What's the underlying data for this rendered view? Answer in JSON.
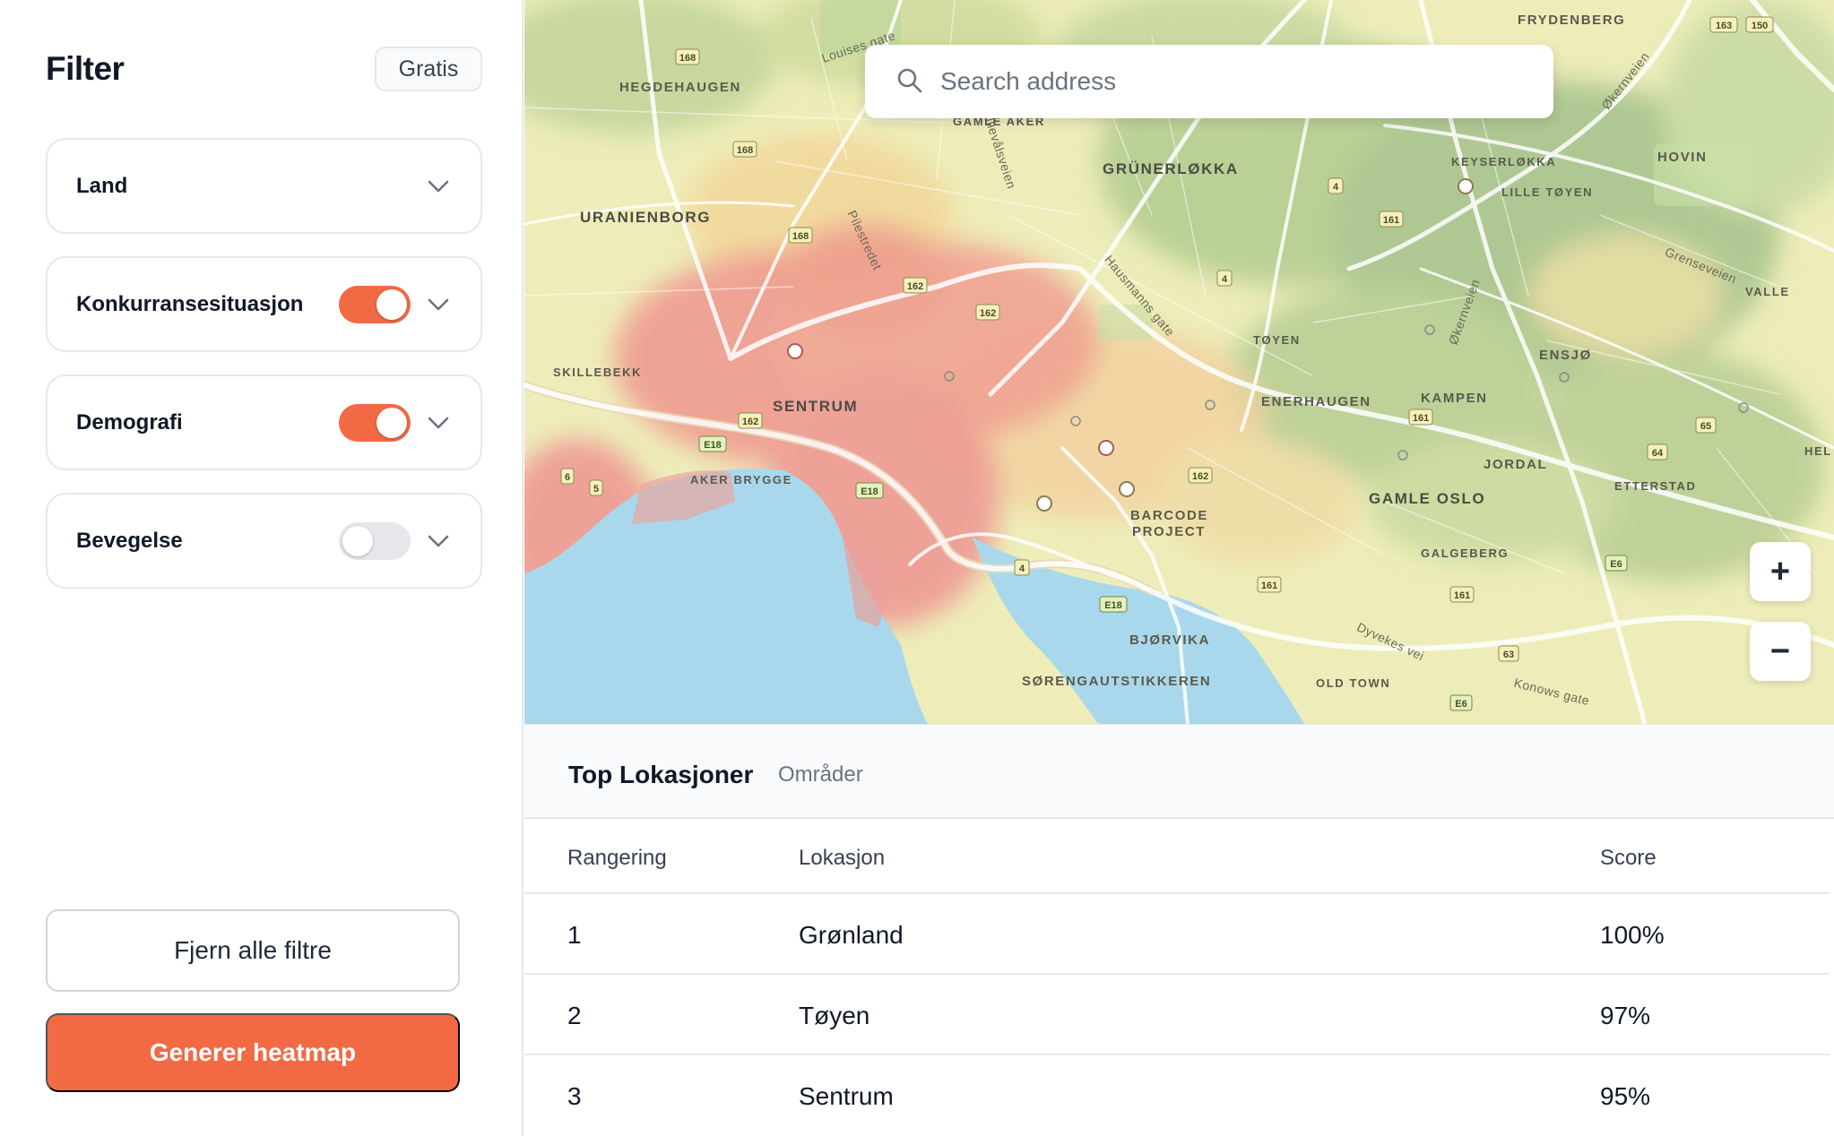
{
  "sidebar": {
    "title": "Filter",
    "plan_badge": "Gratis",
    "filters": [
      {
        "label": "Land",
        "has_toggle": false,
        "icon": "chevron-down-icon"
      },
      {
        "label": "Konkurransesituasjon",
        "has_toggle": true,
        "enabled": true,
        "icon": "chevron-down-icon"
      },
      {
        "label": "Demografi",
        "has_toggle": true,
        "enabled": true,
        "icon": "chevron-down-icon"
      },
      {
        "label": "Bevegelse",
        "has_toggle": true,
        "enabled": false,
        "icon": "chevron-down-icon"
      }
    ],
    "clear_button": "Fjern alle filtre",
    "generate_button": "Generer heatmap",
    "accent_color": "#f26a44"
  },
  "map": {
    "search_placeholder": "Search address",
    "search_icon": "search-icon",
    "zoom_in": "+",
    "zoom_out": "−",
    "labels": {
      "frydenberg": "FRYDENBERG",
      "hegdehaugen": "HEGDEHAUGEN",
      "gamle_aker": "GAMLE AKER",
      "grunerlokka": "GRÜNERLØKKA",
      "keyserlokka": "KEYSERLØKKA",
      "hovin": "HOVIN",
      "lille_toyen": "LILLE TØYEN",
      "uranienborg": "URANIENBORG",
      "valle": "VALLE",
      "toyen": "TØYEN",
      "ensjo": "ENSJØ",
      "skillebekk": "SKILLEBEKK",
      "sentrum": "SENTRUM",
      "enerhaugen": "ENERHAUGEN",
      "kampen": "KAMPEN",
      "aker_brygge": "AKER BRYGGE",
      "jordal": "JORDAL",
      "etterstad": "ETTERSTAD",
      "gamle_oslo": "GAMLE OSLO",
      "barcode": "BARCODE",
      "project": "PROJECT",
      "galgeberg": "GALGEBERG",
      "bjorvika": "BJØRVIKA",
      "sorengautstikkeren": "SØRENGAUTSTIKKEREN",
      "old_town": "OLD TOWN",
      "louises_gate": "Louises gate",
      "ullevalsveien": "Ullevålsveien",
      "pilestredet": "Pilestredet",
      "hausmanns_gate": "Hausmanns gate",
      "okernveien": "Økernveien",
      "grenseveien": "Grenseveien",
      "dyvekes_vei": "Dyvekes vei",
      "konows_gate": "Konows gate",
      "helsfyr": "HEL"
    },
    "road_shields": [
      "168",
      "168",
      "168",
      "162",
      "162",
      "162",
      "162",
      "161",
      "161",
      "161",
      "161",
      "4",
      "4",
      "4",
      "E18",
      "E18",
      "E18",
      "E18",
      "E6",
      "E6",
      "150",
      "163",
      "65",
      "64",
      "63",
      "6",
      "5"
    ],
    "heat_colors": {
      "high": "#ef8f8f",
      "mid": "#f2c48f",
      "low": "#eef0a8",
      "green": "#b4cf8f",
      "deep_green": "#9dbd8c",
      "water": "#a9d8ec"
    }
  },
  "results": {
    "title": "Top Lokasjoner",
    "subtitle": "Områder",
    "columns": [
      "Rangering",
      "Lokasjon",
      "Score"
    ],
    "rows": [
      {
        "rank": "1",
        "location": "Grønland",
        "score": "100%"
      },
      {
        "rank": "2",
        "location": "Tøyen",
        "score": "97%"
      },
      {
        "rank": "3",
        "location": "Sentrum",
        "score": "95%"
      }
    ]
  }
}
